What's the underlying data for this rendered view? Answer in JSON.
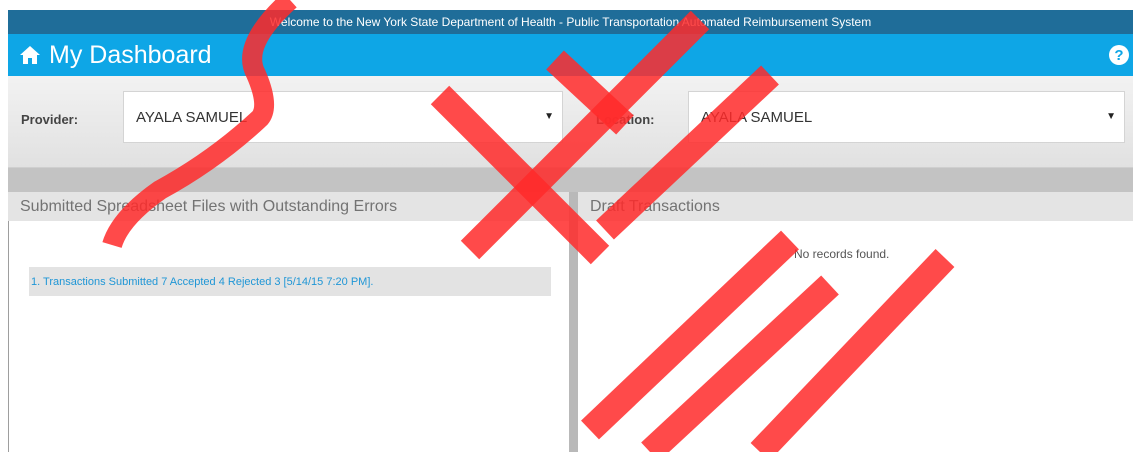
{
  "header": {
    "welcome_text": "Welcome to the New York State Department of Health - Public Transportation Automated Reimbursement System",
    "title": "My Dashboard",
    "home_icon": "home-icon",
    "help_icon": "question-circle-icon",
    "help_glyph": "?"
  },
  "filters": {
    "provider_label": "Provider:",
    "provider_value": "AYALA SAMUEL",
    "location_label": "Location:",
    "location_value": "AYALA SAMUEL",
    "dropdown_glyph": "▼"
  },
  "panels": {
    "left": {
      "title": "Submitted Spreadsheet Files with Outstanding Errors",
      "items": [
        "1. Transactions Submitted 7 Accepted 4 Rejected 3 [5/14/15 7:20 PM]."
      ]
    },
    "right": {
      "title": "Draft Transactions",
      "empty_message": "No records found."
    }
  },
  "colors": {
    "welcome_bar": "#1f6d99",
    "title_bar": "#0ea6e6",
    "link": "#1f96d6",
    "watermark": "#ff2a2a"
  }
}
